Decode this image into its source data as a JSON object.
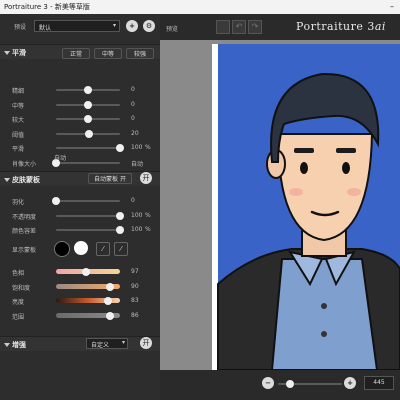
{
  "window": {
    "title": "Portraiture 3 - 新美等草版"
  },
  "preset": {
    "label": "预设",
    "value": "默认"
  },
  "preview_label": "预览",
  "brand": {
    "name": "Portraiture 3",
    "suffix": "ai"
  },
  "smoothing": {
    "title": "平滑",
    "modes": [
      "正常",
      "中等",
      "较强"
    ],
    "sliders": [
      {
        "label": "精细",
        "value": "0",
        "level": 0.5
      },
      {
        "label": "中等",
        "value": "0",
        "level": 0.5
      },
      {
        "label": "较大",
        "value": "0",
        "level": 0.5
      },
      {
        "label": "阈值",
        "value": "20",
        "level": 0.52
      },
      {
        "label": "平滑",
        "value": "100",
        "unit": "%",
        "level": 1.0
      },
      {
        "label": "肖像大小",
        "value": "自动",
        "level": 0.0
      }
    ],
    "auto_label": "自动"
  },
  "skin_mask": {
    "title": "皮肤蒙板",
    "button": "自动蒙板 开",
    "circle": "开",
    "sliders": [
      {
        "label": "羽化",
        "value": "0",
        "level": 0.0
      },
      {
        "label": "不透明度",
        "value": "100",
        "unit": "%",
        "level": 1.0
      },
      {
        "label": "颜色容差",
        "value": "100",
        "unit": "%",
        "level": 1.0
      }
    ],
    "show_mask_label": "显示蒙板",
    "color_sliders": [
      {
        "label": "色相",
        "value": "97",
        "level": 0.47
      },
      {
        "label": "饱和度",
        "value": "90",
        "level": 0.85
      },
      {
        "label": "亮度",
        "value": "83",
        "level": 0.82
      },
      {
        "label": "范围",
        "value": "86",
        "level": 0.84
      }
    ]
  },
  "enhance": {
    "title": "增强",
    "dropdown": "自定义",
    "circle": "开"
  },
  "zoom": {
    "value": "445"
  },
  "colors": {
    "accent": "#3a63c8",
    "panel": "#2d2d2d",
    "canvas": "#8a8a8a"
  }
}
